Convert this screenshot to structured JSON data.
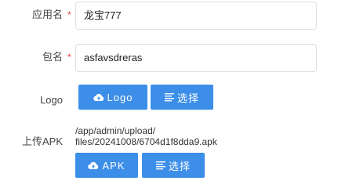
{
  "form": {
    "app_name": {
      "label": "应用名",
      "required_mark": "*",
      "value": "龙宝777"
    },
    "package_name": {
      "label": "包名",
      "required_mark": "*",
      "value": "asfavsdreras"
    },
    "logo": {
      "label": "Logo",
      "upload_button": "Logo",
      "select_button": "选择"
    },
    "apk": {
      "label": "上传APK",
      "path_line1": "/app/admin/upload/",
      "path_line2": "files/20241008/6704d1f8dda9.apk",
      "upload_button": "APK",
      "select_button": "选择"
    }
  },
  "colors": {
    "button_bg": "#3d8ee8",
    "required": "#e53935",
    "input_border": "#dcdfe6"
  },
  "icons": {
    "upload": "cloud-upload-icon",
    "select": "list-icon"
  }
}
